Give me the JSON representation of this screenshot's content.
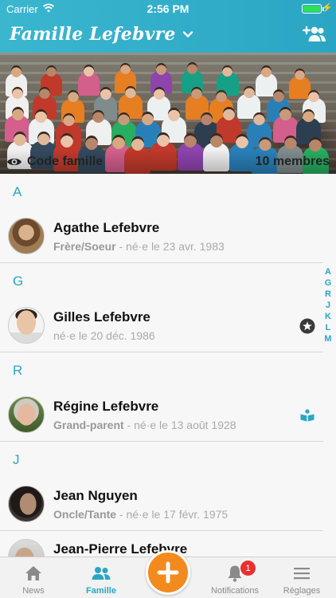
{
  "status_bar": {
    "carrier": "Carrier",
    "time": "2:56 PM"
  },
  "nav": {
    "title": "Famille Lefebvre",
    "icons": {
      "chevron": "chevron-down-icon",
      "add_user": "add-user-icon"
    }
  },
  "hero": {
    "code_label": "Code famille",
    "members": "10 membres",
    "icon": "eye-icon"
  },
  "sections": [
    {
      "letter": "A",
      "members": [
        {
          "name": "Agathe Lefebvre",
          "relation": "Frère/Soeur",
          "birth": " - né·e le 23 avr. 1983",
          "badge": ""
        }
      ]
    },
    {
      "letter": "G",
      "members": [
        {
          "name": "Gilles Lefebvre",
          "relation": "",
          "birth": "né·e le 20 déc. 1986",
          "badge": "star-icon"
        }
      ]
    },
    {
      "letter": "R",
      "members": [
        {
          "name": "Régine Lefebvre",
          "relation": "Grand-parent",
          "birth": " - né·e le 13 août 1928",
          "badge": "reader-icon"
        }
      ]
    },
    {
      "letter": "J",
      "members": [
        {
          "name": "Jean Nguyen",
          "relation": "Oncle/Tante",
          "birth": " - né·e le 17 févr. 1975",
          "badge": ""
        },
        {
          "name": "Jean-Pierre Lefebvre",
          "relation": "",
          "birth": "",
          "badge": ""
        }
      ]
    }
  ],
  "index": [
    "A",
    "G",
    "R",
    "J",
    "K",
    "L",
    "M"
  ],
  "tabs": [
    {
      "label": "News",
      "icon": "home-icon"
    },
    {
      "label": "Famille",
      "icon": "people-icon"
    },
    {
      "label": "",
      "icon": "plus-icon"
    },
    {
      "label": "Notifications",
      "icon": "bell-icon"
    },
    {
      "label": "Réglages",
      "icon": "menu-icon"
    }
  ],
  "notifications_count": "1",
  "colors": {
    "accent": "#2aa6c4",
    "fab": "#f28a1e",
    "badge": "#e8312f",
    "battery": "#2ce05a"
  }
}
